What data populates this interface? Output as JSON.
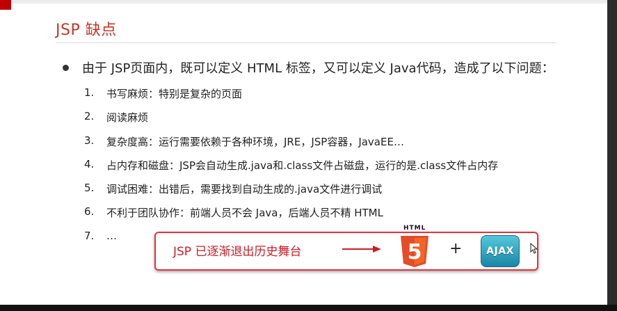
{
  "slide": {
    "title": "JSP 缺点",
    "lead": "由于 JSP页面内，既可以定义 HTML 标签，又可以定义 Java代码，造成了以下问题：",
    "items": [
      {
        "num": "1.",
        "text": "书写麻烦：特别是复杂的页面"
      },
      {
        "num": "2.",
        "text": "阅读麻烦"
      },
      {
        "num": "3.",
        "text": "复杂度高：运行需要依赖于各种环境，JRE，JSP容器，JavaEE…"
      },
      {
        "num": "4.",
        "text": "占内存和磁盘：JSP会自动生成.java和.class文件占磁盘，运行的是.class文件占内存"
      },
      {
        "num": "5.",
        "text": "调试困难：出错后，需要找到自动生成的.java文件进行调试"
      },
      {
        "num": "6.",
        "text": "不利于团队协作：前端人员不会 Java，后端人员不精 HTML"
      },
      {
        "num": "7.",
        "text": "…"
      }
    ],
    "callout": {
      "text": "JSP 已逐渐退出历史舞台",
      "html5_label": "HTML",
      "html5_digit": "5",
      "plus": "+",
      "ajax_label": "AJAX"
    }
  },
  "colors": {
    "accent": "#c0392b",
    "callout_border": "#e2333f",
    "html5_orange": "#e44d26",
    "ajax_blue": "#2aa1c0"
  }
}
